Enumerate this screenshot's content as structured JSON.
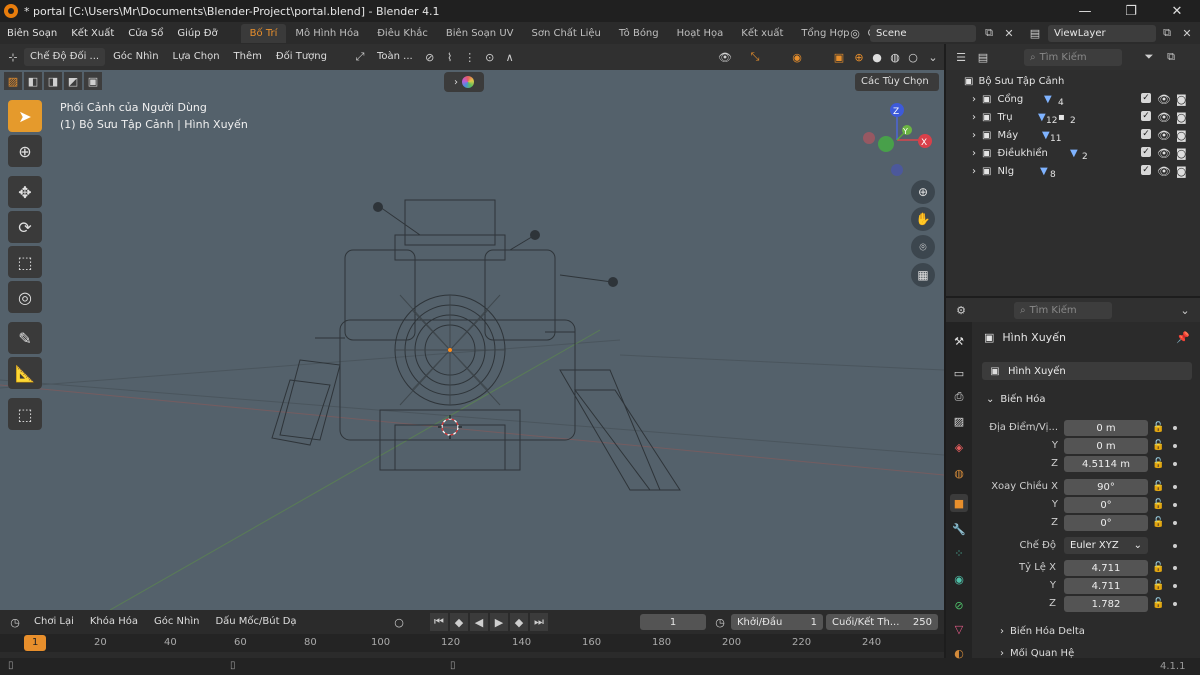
{
  "window": {
    "title": "* portal [C:\\Users\\Mr\\Documents\\Blender-Project\\portal.blend] - Blender 4.1",
    "minimize": "—",
    "restore": "❐",
    "close": "✕"
  },
  "menu": {
    "items": [
      "Biên Soạn",
      "Kết Xuất",
      "Cửa Sổ",
      "Giúp Đỡ"
    ]
  },
  "workspaces": [
    "Bố Trí",
    "Mô Hình Hóa",
    "Điêu Khắc",
    "Biên Soạn UV",
    "Sơn Chất Liệu",
    "Tô Bóng",
    "Hoạt Họa",
    "Kết xuất",
    "Tổng Hợp",
    "Các Nút"
  ],
  "scene": {
    "name": "Scene",
    "viewlayer": "ViewLayer"
  },
  "viewport_header": {
    "mode": "Chế Độ Đối ...",
    "view": "Góc Nhìn",
    "select": "Lựa Chọn",
    "add": "Thêm",
    "object": "Đối Tượng",
    "transform": "Toàn ...",
    "options": "Các Tùy Chọn"
  },
  "viewport": {
    "view_name": "Phối Cảnh của Người Dùng",
    "collection_info": "(1) Bộ Sưu Tập Cảnh | Hình Xuyến",
    "gizmo": {
      "x": "X",
      "y": "Y",
      "z": "Z"
    }
  },
  "outliner": {
    "search_placeholder": "Tìm Kiếm",
    "root": "Bộ Sưu Tập Cảnh",
    "collections": [
      {
        "name": "Cổng",
        "count": "4"
      },
      {
        "name": "Trụ",
        "count": "12",
        "count2": "2"
      },
      {
        "name": "Máy",
        "count": "11"
      },
      {
        "name": "Điềukhiển",
        "count": "2"
      },
      {
        "name": "Nlg",
        "count": "8"
      }
    ]
  },
  "properties": {
    "search_placeholder": "Tìm Kiếm",
    "object_name": "Hình Xuyến",
    "object_field": "Hình Xuyến",
    "transform_panel": "Biến Hóa",
    "location_label": "Địa Điểm/Vị...",
    "location": {
      "x": "0 m",
      "y": "0 m",
      "z": "4.5114 m"
    },
    "rotation_label": "Xoay Chiều X",
    "rotation": {
      "x": "90°",
      "y": "0°",
      "z": "0°"
    },
    "mode_label": "Chế Độ",
    "mode_value": "Euler XYZ",
    "scale_label": "Tỷ Lệ X",
    "scale": {
      "x": "4.711",
      "y": "4.711",
      "z": "1.782"
    },
    "axis_y": "Y",
    "axis_z": "Z",
    "delta_panel": "Biến Hóa Delta",
    "relations_panel": "Mối Quan Hệ"
  },
  "timeline": {
    "playback": "Chơi Lại",
    "keying": "Khóa Hóa",
    "view": "Góc Nhìn",
    "marker": "Dấu Mốc/Bút Dạ",
    "current_frame": "1",
    "start_label": "Khởi/Đầu",
    "start_value": "1",
    "end_label": "Cuối/Kết Th...",
    "end_value": "250",
    "ticks": [
      "1",
      "20",
      "40",
      "60",
      "80",
      "100",
      "120",
      "140",
      "160",
      "180",
      "200",
      "220",
      "240"
    ]
  },
  "status": {
    "version": "4.1.1"
  },
  "colors": {
    "accent": "#e88f2c",
    "viewport_bg": "#54616b",
    "panel": "#2b2b2b",
    "header": "#303030"
  }
}
